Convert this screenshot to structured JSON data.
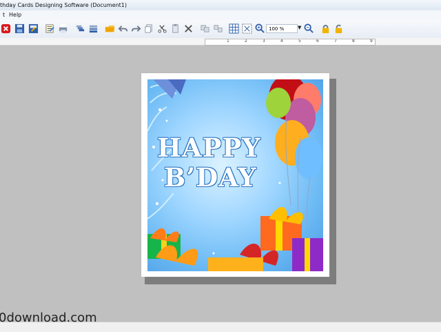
{
  "window": {
    "title": "thday Cards Designing Software  (Document1)"
  },
  "menu": {
    "items": [
      "t",
      "Help"
    ]
  },
  "toolbar": {
    "zoom_value": "100 %",
    "icons": [
      "close-icon",
      "save-icon",
      "save-as-icon",
      "properties-icon",
      "print-icon",
      "bring-front-icon",
      "send-back-icon",
      "open-folder-icon",
      "undo-icon",
      "redo-icon",
      "copy-icon",
      "cut-icon",
      "paste-icon",
      "delete-icon",
      "group-icon",
      "ungroup-icon",
      "grid-icon",
      "select-icon",
      "zoom-in-icon",
      "zoom-out-icon",
      "lock-icon",
      "unlock-icon"
    ]
  },
  "ruler": {
    "marks": [
      "1",
      "2",
      "3",
      "4",
      "5",
      "6",
      "7",
      "8",
      "9"
    ]
  },
  "card": {
    "line1": "HAPPY",
    "line2": "B’DAY"
  },
  "watermark": {
    "text": "0download.com"
  }
}
